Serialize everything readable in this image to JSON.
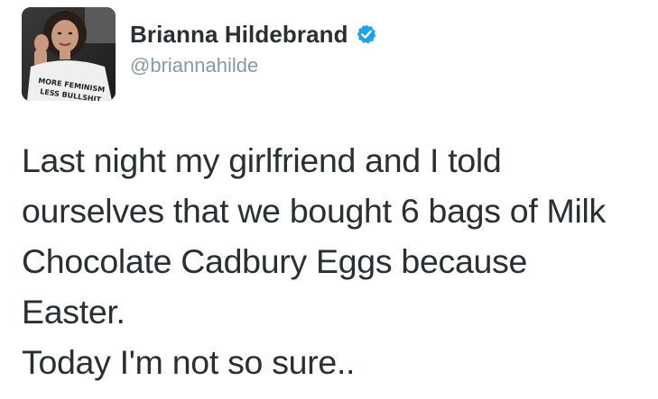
{
  "author": {
    "display_name": "Brianna Hildebrand",
    "username": "@briannahilde",
    "verified": true,
    "verified_icon": "verified-badge-icon",
    "verified_color": "#1da1f2",
    "avatar": {
      "icon": "profile-photo",
      "shirt_text_line1": "MORE FEMINISM",
      "shirt_text_line2": "LESS BULLSHIT"
    }
  },
  "tweet": {
    "lines": [
      "Last night my girlfriend and I told",
      "ourselves that we bought 6 bags of Milk",
      "Chocolate Cadbury Eggs because",
      "Easter.",
      "Today I'm not so sure.."
    ]
  },
  "colors": {
    "text": "#292f33",
    "muted": "#8899a6",
    "background": "#ffffff"
  }
}
